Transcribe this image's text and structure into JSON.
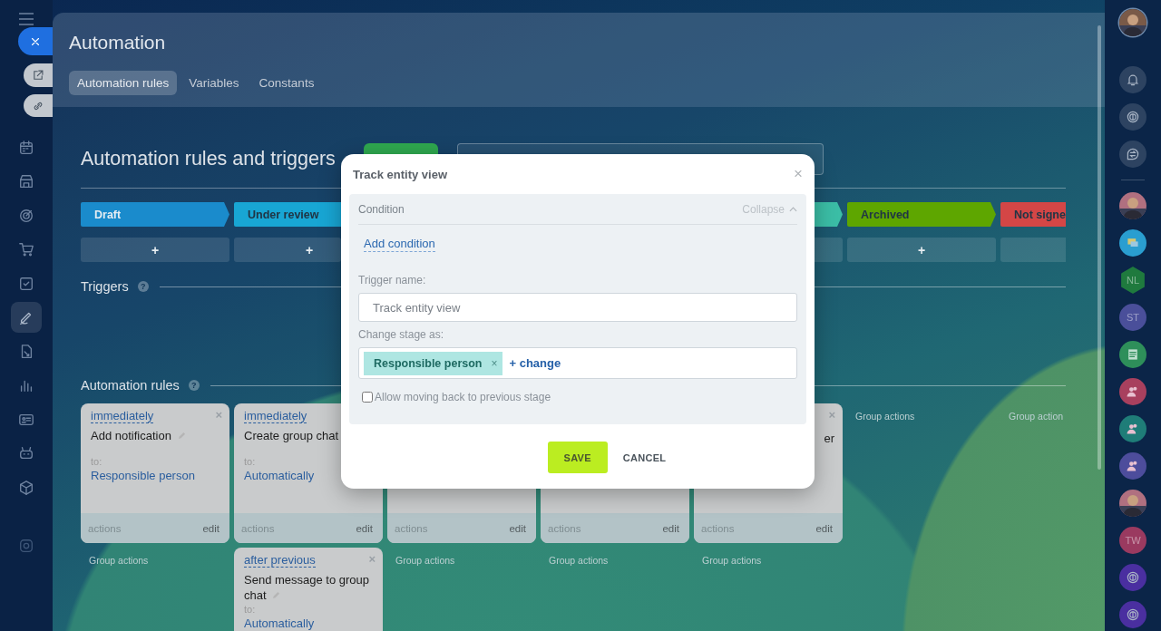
{
  "left_nav": {
    "items": [
      {
        "selected": false
      },
      {
        "selected": false
      },
      {
        "selected": false
      },
      {
        "selected": false
      },
      {
        "selected": false
      },
      {
        "selected": true
      },
      {
        "selected": false
      },
      {
        "selected": false
      },
      {
        "selected": false
      },
      {
        "selected": false
      },
      {
        "selected": false
      },
      {
        "selected": false
      }
    ]
  },
  "floating_buttons": [
    {
      "kind": "close"
    },
    {
      "kind": "open"
    },
    {
      "kind": "link"
    }
  ],
  "header": {
    "title": "Automation",
    "tabs": [
      {
        "label": "Automation rules",
        "selected": true
      },
      {
        "label": "Variables",
        "selected": false
      },
      {
        "label": "Constants",
        "selected": false
      }
    ]
  },
  "page_title": "Automation rules and triggers",
  "stages": [
    {
      "kind": "stage",
      "name": "Draft",
      "color": "#1a8bcc",
      "add": "+"
    },
    {
      "kind": "stage",
      "name": "Under review",
      "color": "#18a6d4",
      "add": "+"
    },
    {
      "kind": "covered"
    },
    {
      "kind": "covered"
    },
    {
      "kind": "stage",
      "color": "#3bbea6"
    },
    {
      "kind": "stage",
      "name": "Archived",
      "color": "#5ea600",
      "add": "+"
    },
    {
      "kind": "stage",
      "name": "Not signe",
      "color": "#d44646"
    }
  ],
  "triggers": {
    "title": "Triggers",
    "help": "?"
  },
  "rules": {
    "title": "Automation rules",
    "help": "?"
  },
  "columns": [
    {
      "cards": [
        {
          "kind": "rule",
          "delay": "immediately",
          "action": "Add notification",
          "editable": true,
          "to_label": "to:",
          "to": "Responsible person",
          "footer_left": "actions",
          "footer_right": "edit",
          "close": "×"
        }
      ],
      "group_actions": "Group actions"
    },
    {
      "cards": [
        {
          "kind": "rule",
          "delay": "immediately",
          "action": "Create group chat",
          "to_label": "to:",
          "to": "Automatically",
          "footer_left": "actions",
          "footer_right": "edit"
        },
        {
          "kind": "rule",
          "delay": "after previous",
          "action": "Send message to group chat",
          "editable": true,
          "to_label": "to:",
          "to": "Automatically",
          "close": "×"
        }
      ]
    },
    {
      "cards": [
        {
          "kind": "covered",
          "footer_left": "actions",
          "footer_right": "edit"
        }
      ],
      "group_actions": "Group actions"
    },
    {
      "cards": [
        {
          "kind": "covered",
          "footer_left": "actions",
          "footer_right": "edit"
        }
      ],
      "group_actions": "Group actions"
    },
    {
      "cards": [
        {
          "kind": "covered",
          "tail": "er",
          "close": "×",
          "footer_left": "actions",
          "footer_right": "edit"
        }
      ],
      "group_actions": "Group actions"
    },
    {
      "group_actions": "Group actions"
    },
    {
      "group_actions": "Group action"
    }
  ],
  "dialog": {
    "title": "Track entity view",
    "close": "×",
    "condition": {
      "label": "Condition",
      "toggle": "Collapse",
      "expanded": true,
      "add": "Add condition"
    },
    "trigger_name": {
      "label": "Trigger name:",
      "value": "Track entity view"
    },
    "change_stage": {
      "label": "Change stage as:",
      "tag": "Responsible person",
      "tag_remove": "×",
      "change": "+ change"
    },
    "allow_back": {
      "label": "Allow moving back to previous stage",
      "checked": false
    },
    "buttons": [
      {
        "kind": "primary",
        "label": "SAVE"
      },
      {
        "kind": "plain",
        "label": "CANCEL"
      }
    ]
  },
  "right_bar": [
    {
      "kind": "picture"
    },
    {
      "kind": "bell"
    },
    {
      "kind": "spiral"
    },
    {
      "kind": "chat"
    },
    {
      "kind": "divider"
    },
    {
      "kind": "picture"
    },
    {
      "kind": "messages",
      "color": "#2a9ed0"
    },
    {
      "kind": "hex-initials",
      "text": "NL",
      "color": "#1f7a3e"
    },
    {
      "kind": "initials",
      "text": "ST",
      "color": "#4a4f9a"
    },
    {
      "kind": "news",
      "color": "#2e8f5a"
    },
    {
      "kind": "group",
      "color": "#a8405e"
    },
    {
      "kind": "group",
      "color": "#1f7d78"
    },
    {
      "kind": "group",
      "color": "#4d4d9c"
    },
    {
      "kind": "picture"
    },
    {
      "kind": "initials",
      "text": "TW",
      "color": "#9a3a60"
    },
    {
      "kind": "spiral",
      "color": "#4a2fa0"
    },
    {
      "kind": "spiral",
      "color": "#4a2fa0"
    }
  ]
}
